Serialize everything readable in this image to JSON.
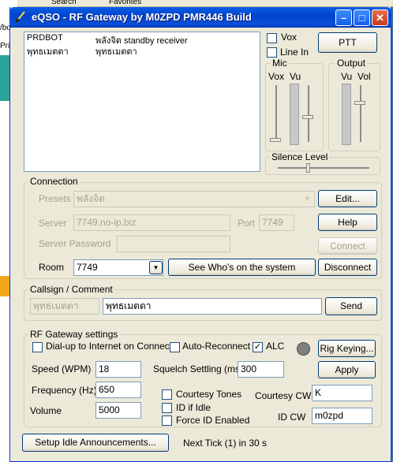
{
  "window": {
    "title": "eQSO - RF Gateway by M0ZPD PMR446 Build"
  },
  "background": {
    "top_items": [
      "Search",
      "Favorites"
    ],
    "side_labels": [
      "/bo",
      "Print"
    ]
  },
  "users": [
    {
      "call": "PRDBOT",
      "info": "พลังจิต standby receiver"
    },
    {
      "call": "พุทธเมตตา",
      "info": "พุทธเมตตา"
    }
  ],
  "audio": {
    "vox_label": "Vox",
    "vox_checked": false,
    "line_in_label": "Line In",
    "line_in_checked": false,
    "ptt_label": "PTT",
    "mic_group": "Mic",
    "mic_vox": "Vox",
    "mic_vu": "Vu",
    "output_group": "Output",
    "out_vu": "Vu",
    "out_vol": "Vol",
    "silence_label": "Silence Level"
  },
  "connection": {
    "group": "Connection",
    "presets_label": "Presets",
    "presets_value": "พลังจิต",
    "edit_label": "Edit...",
    "server_label": "Server",
    "server_value": "7749.no-ip.biz",
    "port_label": "Port",
    "port_value": "7749",
    "help_label": "Help",
    "password_label": "Server Password",
    "password_value": "",
    "connect_label": "Connect",
    "room_label": "Room",
    "room_value": "7749",
    "whos_label": "See Who's on the system",
    "disconnect_label": "Disconnect"
  },
  "callsign": {
    "group": "Callsign / Comment",
    "callsign_value": "พุทธเมตตา",
    "comment_value": "พุทธเมตตา",
    "send_label": "Send"
  },
  "rf": {
    "group": "RF Gateway settings",
    "dialup_label": "Dial-up to Internet on Connect",
    "dialup_checked": false,
    "autoreconnect_label": "Auto-Reconnect",
    "autoreconnect_checked": false,
    "alc_label": "ALC",
    "alc_checked": true,
    "check_mark": "✓",
    "rig_label": "Rig Keying...",
    "apply_label": "Apply",
    "speed_label": "Speed (WPM)",
    "speed_value": "18",
    "squelch_label": "Squelch Settling (ms)",
    "squelch_value": "300",
    "freq_label": "Frequency (Hz)",
    "freq_value": "650",
    "courtesy_tones_label": "Courtesy Tones",
    "courtesy_tones_checked": false,
    "courtesy_cw_label": "Courtesy CW",
    "courtesy_cw_value": "K",
    "volume_label": "Volume",
    "volume_value": "5000",
    "id_if_idle_label": "ID if Idle",
    "id_if_idle_checked": false,
    "id_cw_label": "ID CW",
    "id_cw_value": "m0zpd",
    "force_id_label": "Force ID Enabled",
    "force_id_checked": false
  },
  "footer": {
    "idle_label": "Setup Idle Announcements...",
    "next_tick": "Next Tick (1) in 30 s"
  },
  "colors": {
    "titlebar": "#0044cc",
    "window_bg": "#ece9d8",
    "rig_indicator": "#808080"
  }
}
